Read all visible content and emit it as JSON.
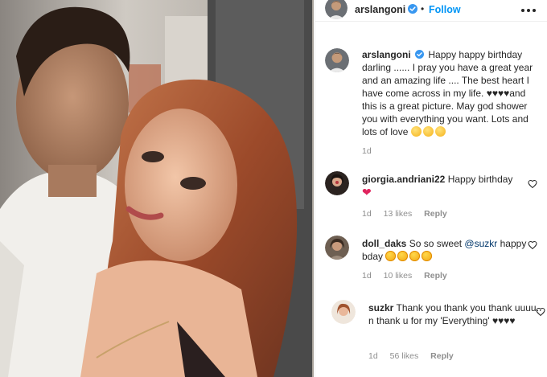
{
  "header": {
    "username": "arslangoni",
    "follow_label": "Follow"
  },
  "caption": {
    "username": "arslangoni",
    "text": "Happy happy birthday darling ...... I pray you have a great year and an amazing life .... The best heart I have come across in my life. ♥♥♥♥and this is a great picture. May god shower you with everything you want. Lots and lots of love",
    "time": "1d"
  },
  "comments": [
    {
      "username": "giorgia.andriani22",
      "text": "Happy birthday",
      "time": "1d",
      "likes": "13 likes",
      "reply_label": "Reply"
    },
    {
      "username": "doll_daks",
      "text_before": "So so sweet",
      "mention": "@suzkr",
      "text_after": "happy bday",
      "time": "1d",
      "likes": "10 likes",
      "reply_label": "Reply"
    },
    {
      "username": "suzkr",
      "text": "Thank you thank you thank uuuu.. n thank u for my 'Everything' ♥♥♥♥",
      "time": "1d",
      "likes": "56 likes",
      "reply_label": "Reply"
    }
  ],
  "colors": {
    "link_blue": "#0095f6",
    "verified_blue": "#3897f0",
    "muted": "#8e8e8e",
    "text": "#262626"
  },
  "icons": {
    "verified": "verified-badge-icon",
    "more": "more-horizontal-icon",
    "like": "heart-outline-icon"
  }
}
